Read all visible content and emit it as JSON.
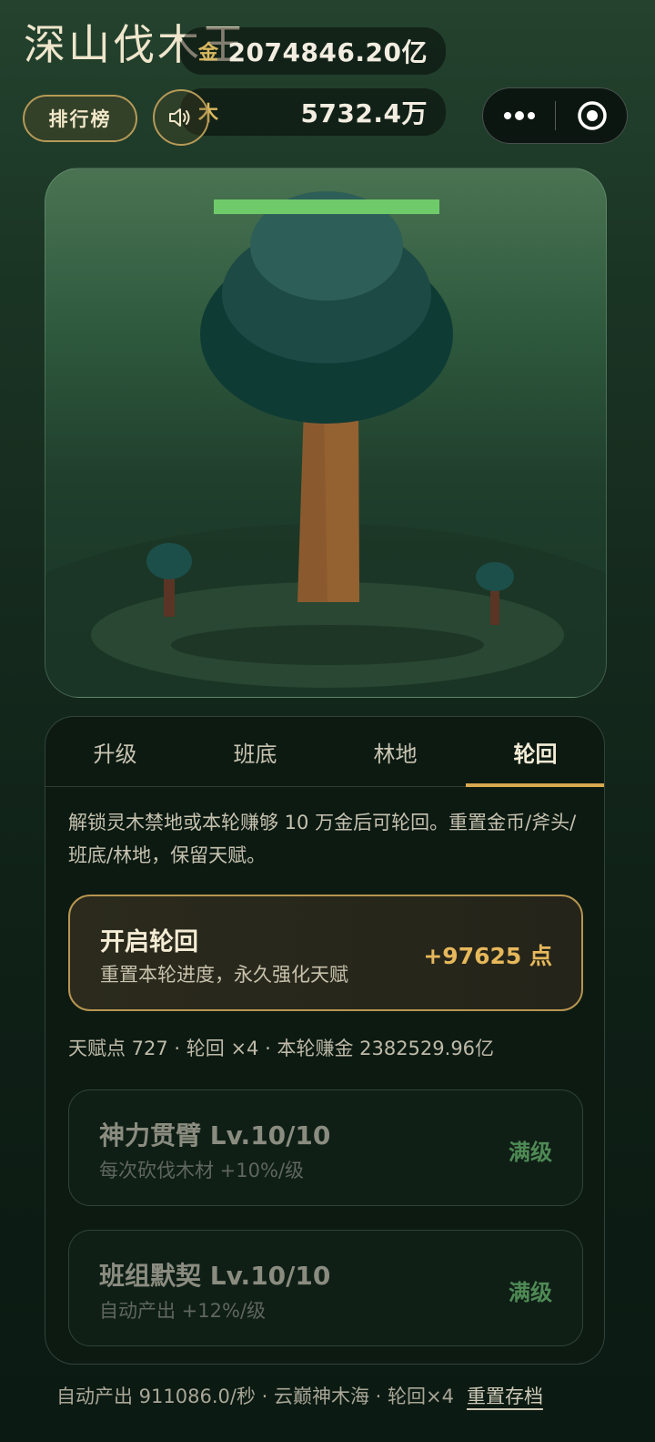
{
  "header": {
    "title": "深山伐木王",
    "gold": {
      "icon": "金",
      "value": "2074846.20亿"
    },
    "wood": {
      "icon": "木",
      "value": "5732.4万"
    },
    "rank_button": "排行榜"
  },
  "scene": {
    "tree_hp_fraction": 1.0,
    "colors": {
      "hp_bar": "#6fcb6a",
      "trunk": "#8a5a2e",
      "canopy": "#1d4a45"
    }
  },
  "tabs": [
    {
      "label": "升级",
      "active": false
    },
    {
      "label": "班底",
      "active": false
    },
    {
      "label": "林地",
      "active": false
    },
    {
      "label": "轮回",
      "active": true
    }
  ],
  "rebirth": {
    "description": "解锁灵木禁地或本轮赚够 10 万金后可轮回。重置金币/斧头/班底/林地，保留天赋。",
    "button_title": "开启轮回",
    "button_subtitle": "重置本轮进度，永久强化天赋",
    "button_points": "+97625 点",
    "stats": "天赋点 727 · 轮回 ×4 · 本轮赚金 2382529.96亿"
  },
  "talents": [
    {
      "name": "神力贯臂 Lv.10/10",
      "desc": "每次砍伐木材 +10%/级",
      "status": "满级"
    },
    {
      "name": "班组默契 Lv.10/10",
      "desc": "自动产出 +12%/级",
      "status": "满级"
    }
  ],
  "footer": {
    "text": "自动产出 911086.0/秒 · 云巅神木海 · 轮回×4",
    "reset_link": "重置存档"
  }
}
